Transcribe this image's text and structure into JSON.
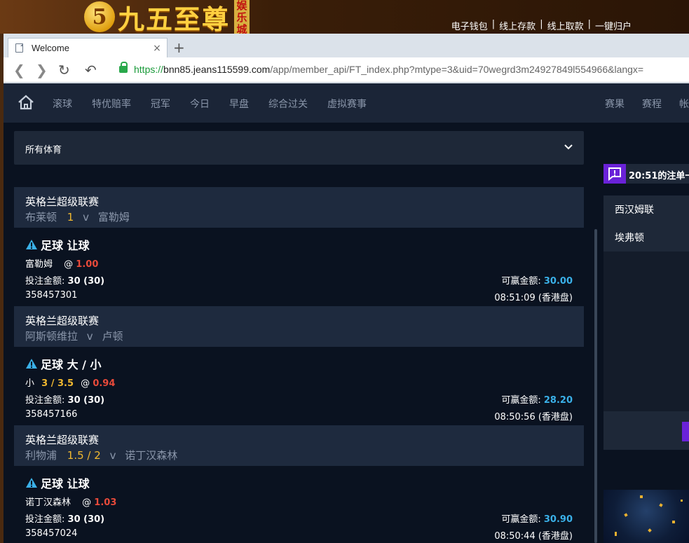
{
  "banner": {
    "logo_glyph": "5",
    "logo_text": "九五至尊",
    "logo_sub": [
      "娱",
      "乐",
      "城"
    ],
    "links": [
      "电子钱包",
      "线上存款",
      "线上取款",
      "一键归户"
    ],
    "link_separator": "|"
  },
  "browser": {
    "tab_title": "Welcome",
    "tab_close": "×",
    "new_tab": "+",
    "url_scheme": "https://",
    "url_host": "bnn85.jeans115599.com",
    "url_path": "/app/member_api/FT_index.php?mtype=3&uid=70wegrd3m24927849l554966&langx="
  },
  "nav": {
    "items": [
      "滚球",
      "特优赔率",
      "冠军",
      "今日",
      "早盘",
      "综合过关",
      "虚拟赛事"
    ],
    "right_items": [
      "赛果",
      "赛程",
      "帐"
    ]
  },
  "filter": {
    "label": "所有体育"
  },
  "bets": [
    {
      "league": "英格兰超级联赛",
      "home": "布莱顿",
      "handicap": "1",
      "vs": "v",
      "away": "富勒姆",
      "type": "足球 让球",
      "pick": "富勒姆",
      "pick_line": "",
      "at": "@",
      "odds": "1.00",
      "stake_label": "投注金额:",
      "stake": "30 (30)",
      "win_label": "可赢金额:",
      "win": "30.00",
      "ticket": "358457301",
      "time": "08:51:09 (香港盘)"
    },
    {
      "league": "英格兰超级联赛",
      "home": "阿斯顿维拉",
      "handicap": "",
      "vs": "v",
      "away": "卢顿",
      "type": "足球 大 / 小",
      "pick": "小",
      "pick_line": "3 / 3.5",
      "at": "@",
      "odds": "0.94",
      "stake_label": "投注金额:",
      "stake": "30 (30)",
      "win_label": "可赢金额:",
      "win": "28.20",
      "ticket": "358457166",
      "time": "08:50:56 (香港盘)"
    },
    {
      "league": "英格兰超级联赛",
      "home": "利物浦",
      "handicap": "1.5 / 2",
      "vs": "v",
      "away": "诺丁汉森林",
      "type": "足球 让球",
      "pick": "诺丁汉森林",
      "pick_line": "",
      "at": "@",
      "odds": "1.03",
      "stake_label": "投注金额:",
      "stake": "30 (30)",
      "win_label": "可赢金额:",
      "win": "30.90",
      "ticket": "358457024",
      "time": "08:50:44 (香港盘)"
    }
  ],
  "right_panel": {
    "title": "20:51的注单一",
    "teams": [
      "西汉姆联",
      "埃弗顿"
    ]
  },
  "colors": {
    "accent_purple": "#6a22d8",
    "odds_red": "#e84a3a",
    "highlight_yellow": "#f0b830",
    "win_blue": "#3ab0e8"
  }
}
